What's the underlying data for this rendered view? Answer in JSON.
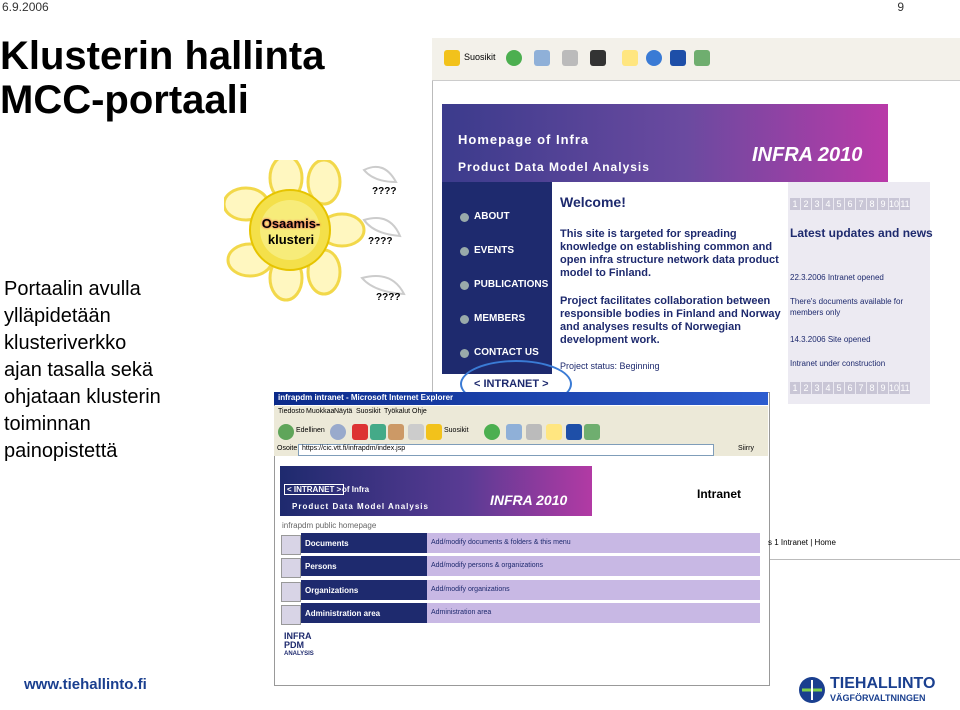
{
  "slide": {
    "date": "6.9.2006",
    "page_number": "9",
    "title_line1": "Klusterin hallinta",
    "title_line2": "MCC-portaali",
    "body_lines": [
      "Portaalin avulla",
      "ylläpidetään",
      "klusteriverkko",
      "ajan tasalla sekä",
      "ohjataan klusterin",
      "toiminnan",
      "painopistettä"
    ],
    "footer_url": "www.tiehallinto.fi",
    "logo_text": "TIEHALLINTO",
    "logo_sub": "VÄGFÖRVALTNINGEN"
  },
  "flower": {
    "label_line1": "Osaamis-",
    "label_line2": "klusteri",
    "question_marks": [
      "????",
      "????",
      "????"
    ]
  },
  "portal_window": {
    "toolbar": {
      "favorites_label": "Suosikit"
    },
    "banner": {
      "home": "Homepage of Infra",
      "pdm": "Product Data Model Analysis",
      "logo": "INFRA 2010"
    },
    "nav": [
      "ABOUT",
      "EVENTS",
      "PUBLICATIONS",
      "MEMBERS",
      "CONTACT US"
    ],
    "welcome": "Welcome!",
    "paragraph1": "This site is targeted for spreading knowledge on establishing common and open infra structure network data product model to Finland.",
    "paragraph2": "Project facilitates collaboration between responsible bodies in Finland and Norway and analyses results of Norwegian development work.",
    "status": "Project status: Beginning",
    "intranet_link": "< INTRANET >",
    "pager": [
      "1",
      "2",
      "3",
      "4",
      "5",
      "6",
      "7",
      "8",
      "9",
      "10",
      "11",
      "12"
    ],
    "latest_title": "Latest updates and news",
    "updates": [
      {
        "date": "22.3.2006 Intranet opened",
        "text": "There's documents available for members only"
      },
      {
        "date": "14.3.2006 Site opened",
        "text": "Intranet under construction"
      }
    ]
  },
  "intranet_window": {
    "title": "infrapdm intranet - Microsoft Internet Explorer",
    "menu": [
      "Tiedosto",
      "Muokkaa",
      "Näytä",
      "Suosikit",
      "Työkalut",
      "Ohje"
    ],
    "toolbar": {
      "back": "Edellinen",
      "favorites": "Suosikit"
    },
    "address_label": "Osoite",
    "address_value": "https://cic.vtt.fi/infrapdm/index.jsp",
    "go_label": "Siirry",
    "banner": {
      "intranet_link": "< INTRANET >",
      "of_infra": "of Infra",
      "pdm": "Product Data Model Analysis",
      "logo": "INFRA 2010"
    },
    "intranet_word": "Intranet",
    "public_home": "infrapdm public homepage",
    "right_links": "s 1 Intranet | Home",
    "rows": [
      {
        "label": "Documents",
        "desc": "Add/modify documents & folders & this menu"
      },
      {
        "label": "Persons",
        "desc": "Add/modify persons & organizations"
      },
      {
        "label": "Organizations",
        "desc": "Add/modify organizations"
      },
      {
        "label": "Administration area",
        "desc": "Administration area"
      }
    ],
    "pdm_logo": {
      "line1": "INFRA",
      "line2": "PDM",
      "line3": "ANALYSIS"
    }
  }
}
